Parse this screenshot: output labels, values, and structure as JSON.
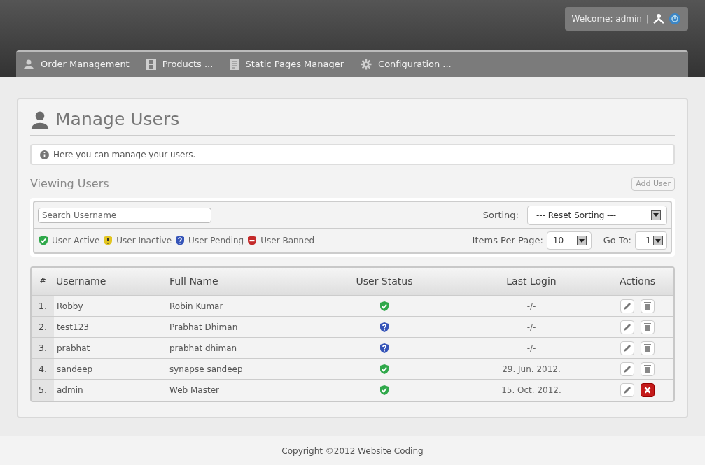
{
  "header": {
    "welcome": "Welcome: admin",
    "separator": "|"
  },
  "nav": [
    {
      "label": "Order Management"
    },
    {
      "label": "Products ..."
    },
    {
      "label": "Static Pages Manager"
    },
    {
      "label": "Configuration ..."
    }
  ],
  "page": {
    "title": "Manage Users",
    "info": "Here you can manage your users.",
    "section": "Viewing Users",
    "add_button": "Add User"
  },
  "filters": {
    "search_placeholder": "Search Username",
    "sorting_label": "Sorting:",
    "sorting_value": "--- Reset Sorting ---",
    "per_page_label": "Items Per Page:",
    "per_page_value": "10",
    "goto_label": "Go To:",
    "goto_value": "1"
  },
  "legend": [
    {
      "kind": "active",
      "label": "User Active"
    },
    {
      "kind": "inactive",
      "label": "User Inactive"
    },
    {
      "kind": "pending",
      "label": "User Pending"
    },
    {
      "kind": "banned",
      "label": "User Banned"
    }
  ],
  "table": {
    "columns": [
      "#",
      "Username",
      "Full Name",
      "User Status",
      "Last Login",
      "Actions"
    ],
    "rows": [
      {
        "num": "1.",
        "username": "Robby",
        "full_name": "Robin Kumar",
        "status": {
          "kind": "active"
        },
        "last_login": "-/-",
        "delete": {
          "kind": "trash"
        }
      },
      {
        "num": "2.",
        "username": "test123",
        "full_name": "Prabhat Dhiman",
        "status": {
          "kind": "pending"
        },
        "last_login": "-/-",
        "delete": {
          "kind": "trash"
        }
      },
      {
        "num": "3.",
        "username": "prabhat",
        "full_name": "prabhat dhiman",
        "status": {
          "kind": "pending"
        },
        "last_login": "-/-",
        "delete": {
          "kind": "trash"
        }
      },
      {
        "num": "4.",
        "username": "sandeep",
        "full_name": "synapse sandeep",
        "status": {
          "kind": "active"
        },
        "last_login": "29. Jun. 2012.",
        "delete": {
          "kind": "trash"
        }
      },
      {
        "num": "5.",
        "username": "admin",
        "full_name": "Web Master",
        "status": {
          "kind": "active"
        },
        "last_login": "15. Oct. 2012.",
        "delete": {
          "kind": "cross"
        }
      }
    ]
  },
  "footer": "Copyright ©2012 Website Coding"
}
